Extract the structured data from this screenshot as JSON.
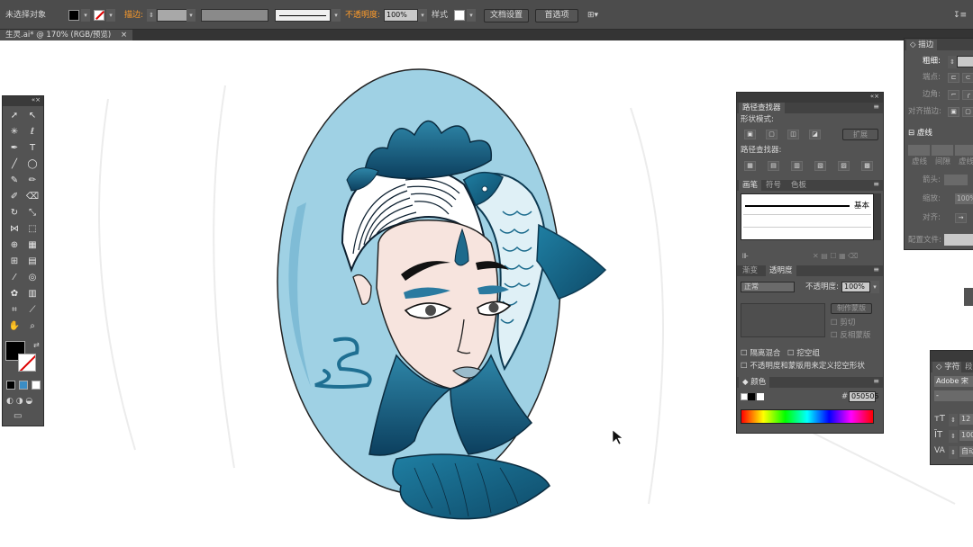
{
  "control_bar": {
    "selection_label": "未选择对象",
    "stroke_label": "描边:",
    "opacity_label": "不透明度:",
    "opacity_value": "100%",
    "style_label": "样式",
    "doc_setup": "文档设置",
    "preferences": "首选项"
  },
  "document_tab": {
    "title": "生灵.ai* @ 170% (RGB/预览)",
    "close": "×"
  },
  "stroke_panel": {
    "tab": "描边",
    "weight_label": "粗细:",
    "cap_label": "端点:",
    "corner_label": "边角:",
    "align_label": "对齐描边:",
    "dashed_label": "虚线",
    "dash_cols": [
      "虚线",
      "间隙",
      "虚线"
    ],
    "arrow_label": "箭头:",
    "scale_label": "缩放:",
    "scale_value": "100%",
    "align2_label": "对齐:",
    "profile_label": "配置文件:"
  },
  "pathfinder_panel": {
    "tab": "路径查找器",
    "shape_modes": "形状模式:",
    "expand": "扩展",
    "pathfinders": "路径查找器:"
  },
  "brush_panel": {
    "tabs": [
      "画笔",
      "符号",
      "色板"
    ],
    "basic": "基本"
  },
  "transparency_panel": {
    "tabs": [
      "渐变",
      "透明度"
    ],
    "blend_mode": "正常",
    "opacity_label": "不透明度:",
    "opacity_value": "100%",
    "make_mask": "制作蒙版",
    "clip": "剪切",
    "invert": "反相蒙版",
    "isolate": "隔离混合",
    "knockout": "挖空组",
    "define_knockout": "不透明度和蒙版用来定义挖空形状"
  },
  "color_panel": {
    "tab": "颜色",
    "hex_label": "#",
    "hex_value": "050505"
  },
  "char_panel": {
    "tabs": [
      "字符",
      "段"
    ],
    "font": "Adobe 宋",
    "size": "12",
    "leading": "100",
    "tracking": "自动"
  },
  "colors": {
    "accent": "#1e6a8c",
    "background_oval": "#9fd1e4",
    "skin": "#f7e4de"
  }
}
